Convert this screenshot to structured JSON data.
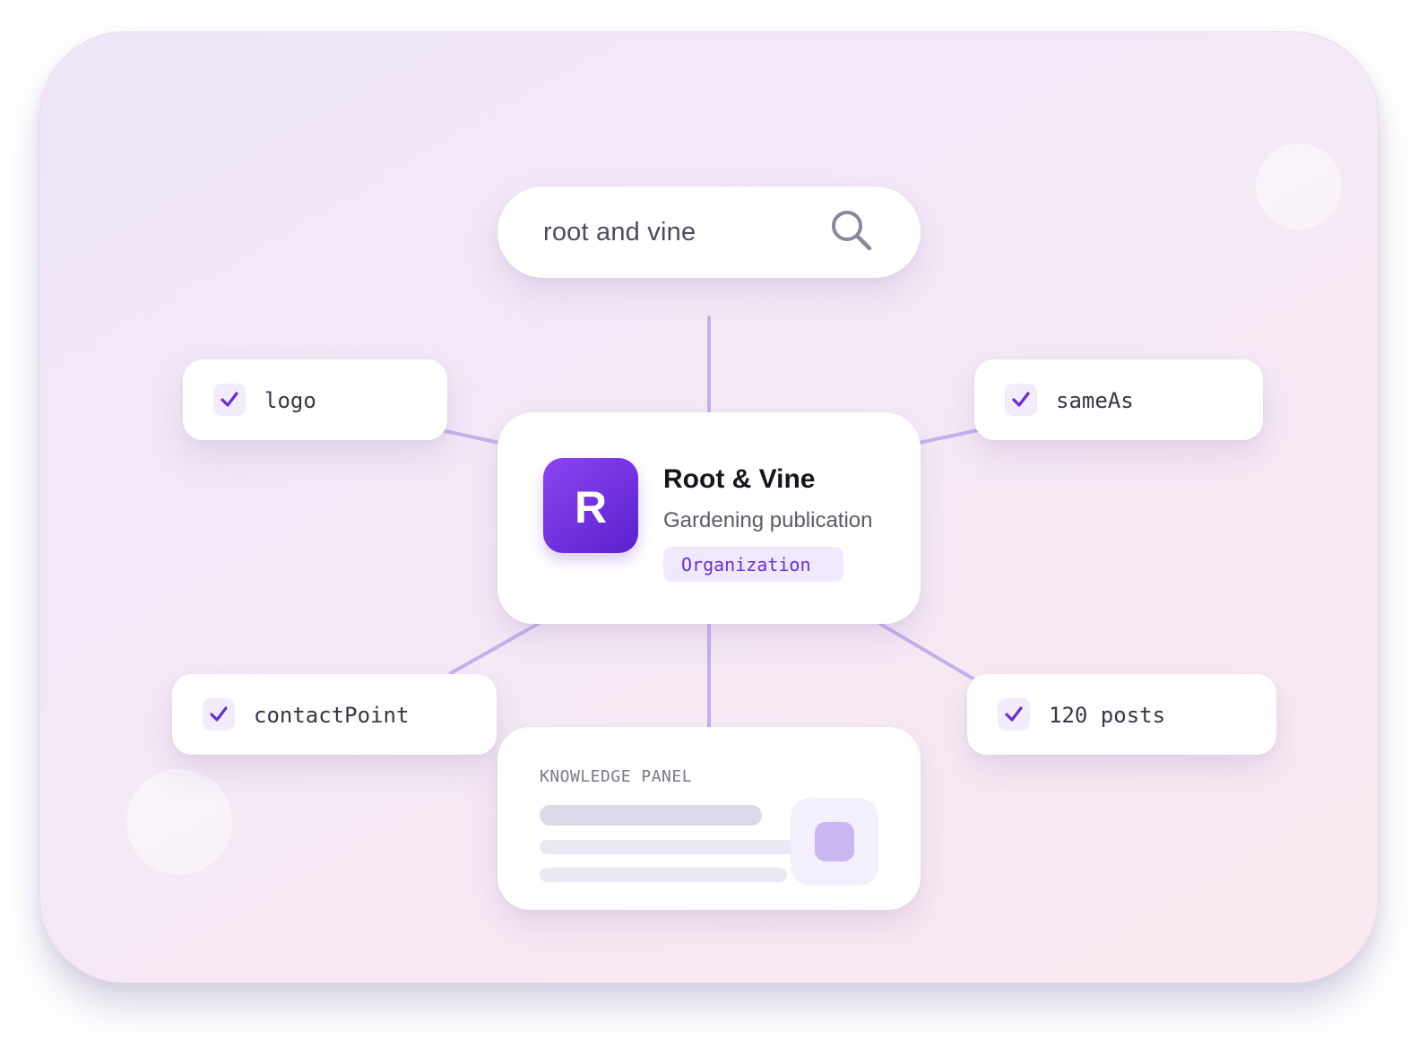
{
  "search": {
    "query": "root and vine",
    "icon": "search-icon"
  },
  "entity": {
    "initial": "R",
    "name": "Root & Vine",
    "subtitle": "Gardening publication",
    "type_tag": "Organization"
  },
  "properties": {
    "logo": "logo",
    "same_as": "sameAs",
    "contact_point": "contactPoint",
    "posts": "120 posts"
  },
  "knowledge_panel": {
    "title": "KNOWLEDGE PANEL"
  },
  "colors": {
    "accent": "#6a2ed8",
    "connector": "#c3b0ee",
    "avatar_gradient_start": "#8b45f0",
    "avatar_gradient_end": "#5b20d0"
  }
}
